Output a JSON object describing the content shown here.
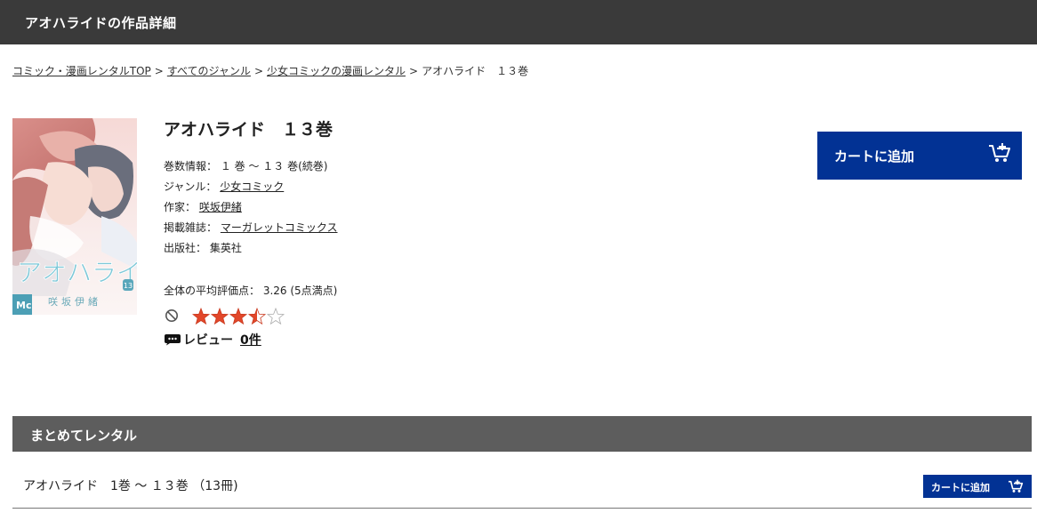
{
  "header": {
    "title": "アオハライドの作品詳細"
  },
  "breadcrumb": {
    "items": [
      "コミック・漫画レンタルTOP",
      "すべてのジャンル",
      "少女コミックの漫画レンタル"
    ],
    "current": "アオハライド　１３巻",
    "separator": ">"
  },
  "cover": {
    "title_lettering": "アオハライド",
    "author_lettering": "咲坂伊緒",
    "volume": "13",
    "imprint": "Mc"
  },
  "product": {
    "title": "アオハライド　１３巻",
    "volumes_label": "巻数情報：",
    "volumes_value": "１ 巻 ～ １３ 巻(続巻)",
    "genre_label": "ジャンル：",
    "genre_value": "少女コミック",
    "author_label": "作家：",
    "author_value": "咲坂伊緒",
    "magazine_label": "掲載雑誌：",
    "magazine_value": "マーガレットコミックス",
    "publisher_label": "出版社：",
    "publisher_value": "集英社",
    "rating_text": "全体の平均評価点： 3.26 (5点満点)",
    "rating_value": 3.26,
    "rating_max": 5,
    "review_label": "レビュー",
    "review_count": "0件"
  },
  "cart": {
    "add_label": "カートに追加"
  },
  "bundle": {
    "section_title": "まとめてレンタル",
    "item_text": "アオハライド　1巻 ～ １３巻 （13冊)",
    "add_label": "カートに追加"
  },
  "colors": {
    "header_bg": "#3a3a3a",
    "section_bg": "#5d5d5d",
    "cart_button": "#023294",
    "star": "#e2472a"
  }
}
